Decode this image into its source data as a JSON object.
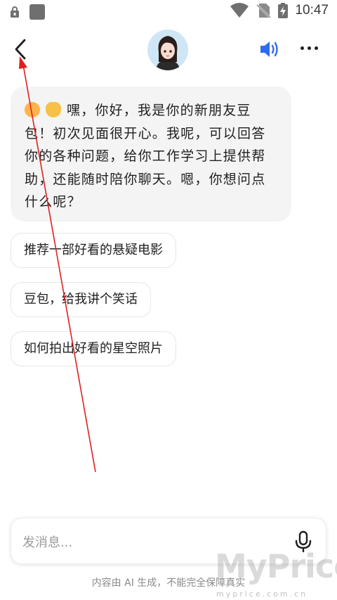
{
  "status_bar": {
    "time": "10:47",
    "icons": [
      "lock-icon",
      "app-icon",
      "wifi-icon",
      "no-sim-icon",
      "battery-charging-icon"
    ]
  },
  "header": {
    "back_icon": "chevron-left-icon",
    "avatar": "assistant-avatar",
    "speaker_icon": "speaker-icon",
    "more_icon": "more-icon",
    "accent_color": "#2f6bf0"
  },
  "chat": {
    "greeting_emoji": [
      "smile-emoji",
      "wave-emoji"
    ],
    "greeting_lines": [
      "嘿，你好，我是你的新朋友豆",
      "包！初次见面很开心。我呢，可以回答",
      "你的各种问题，给你工作学习上提供帮",
      "助，还能随时陪你聊天。嗯，你想问点",
      "什么呢？"
    ],
    "suggestions": [
      "推荐一部好看的悬疑电影",
      "豆包，给我讲个笑话",
      "如何拍出好看的星空照片"
    ]
  },
  "input": {
    "placeholder": "发消息...",
    "value": "",
    "mic_icon": "microphone-icon"
  },
  "disclaimer": "内容由 AI 生成，不能完全保障真实",
  "watermark": {
    "brand": "MyPrice",
    "domain": "myprice.com.cn"
  },
  "annotation": {
    "arrow_color": "#e02020"
  }
}
